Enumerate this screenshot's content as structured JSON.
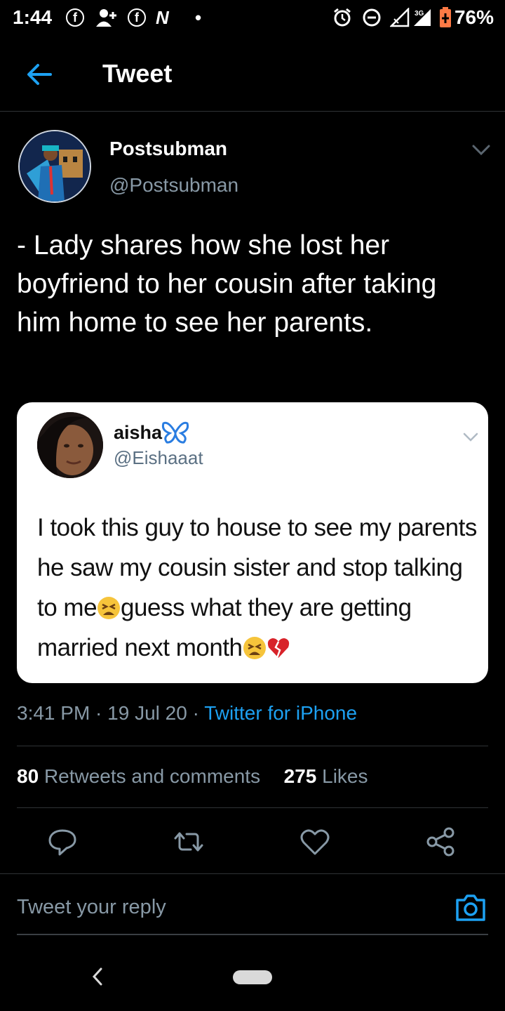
{
  "status_bar": {
    "time": "1:44",
    "battery": "76%",
    "network": "3G"
  },
  "header": {
    "title": "Tweet"
  },
  "author": {
    "name": "Postsubman",
    "handle": "@Postsubman"
  },
  "tweet": {
    "text": "- Lady shares how she lost her boyfriend to her cousin after taking him home to see her parents."
  },
  "quoted": {
    "name": "aisha",
    "handle": "@Eishaaat",
    "text_1": "I took this guy to house to see my parents he saw my cousin sister and stop talking to me",
    "text_2": "guess what they are getting married next month"
  },
  "meta": {
    "time": "3:41 PM",
    "sep1": " · ",
    "date": "19 Jul 20",
    "sep2": " · ",
    "source": "Twitter for iPhone"
  },
  "stats": {
    "retweets_count": "80",
    "retweets_label": "Retweets and comments",
    "likes_count": "275",
    "likes_label": "Likes"
  },
  "reply": {
    "placeholder": "Tweet your reply"
  },
  "colors": {
    "accent": "#1da1f2",
    "muted": "#8899a6",
    "divider": "#2f3336"
  }
}
